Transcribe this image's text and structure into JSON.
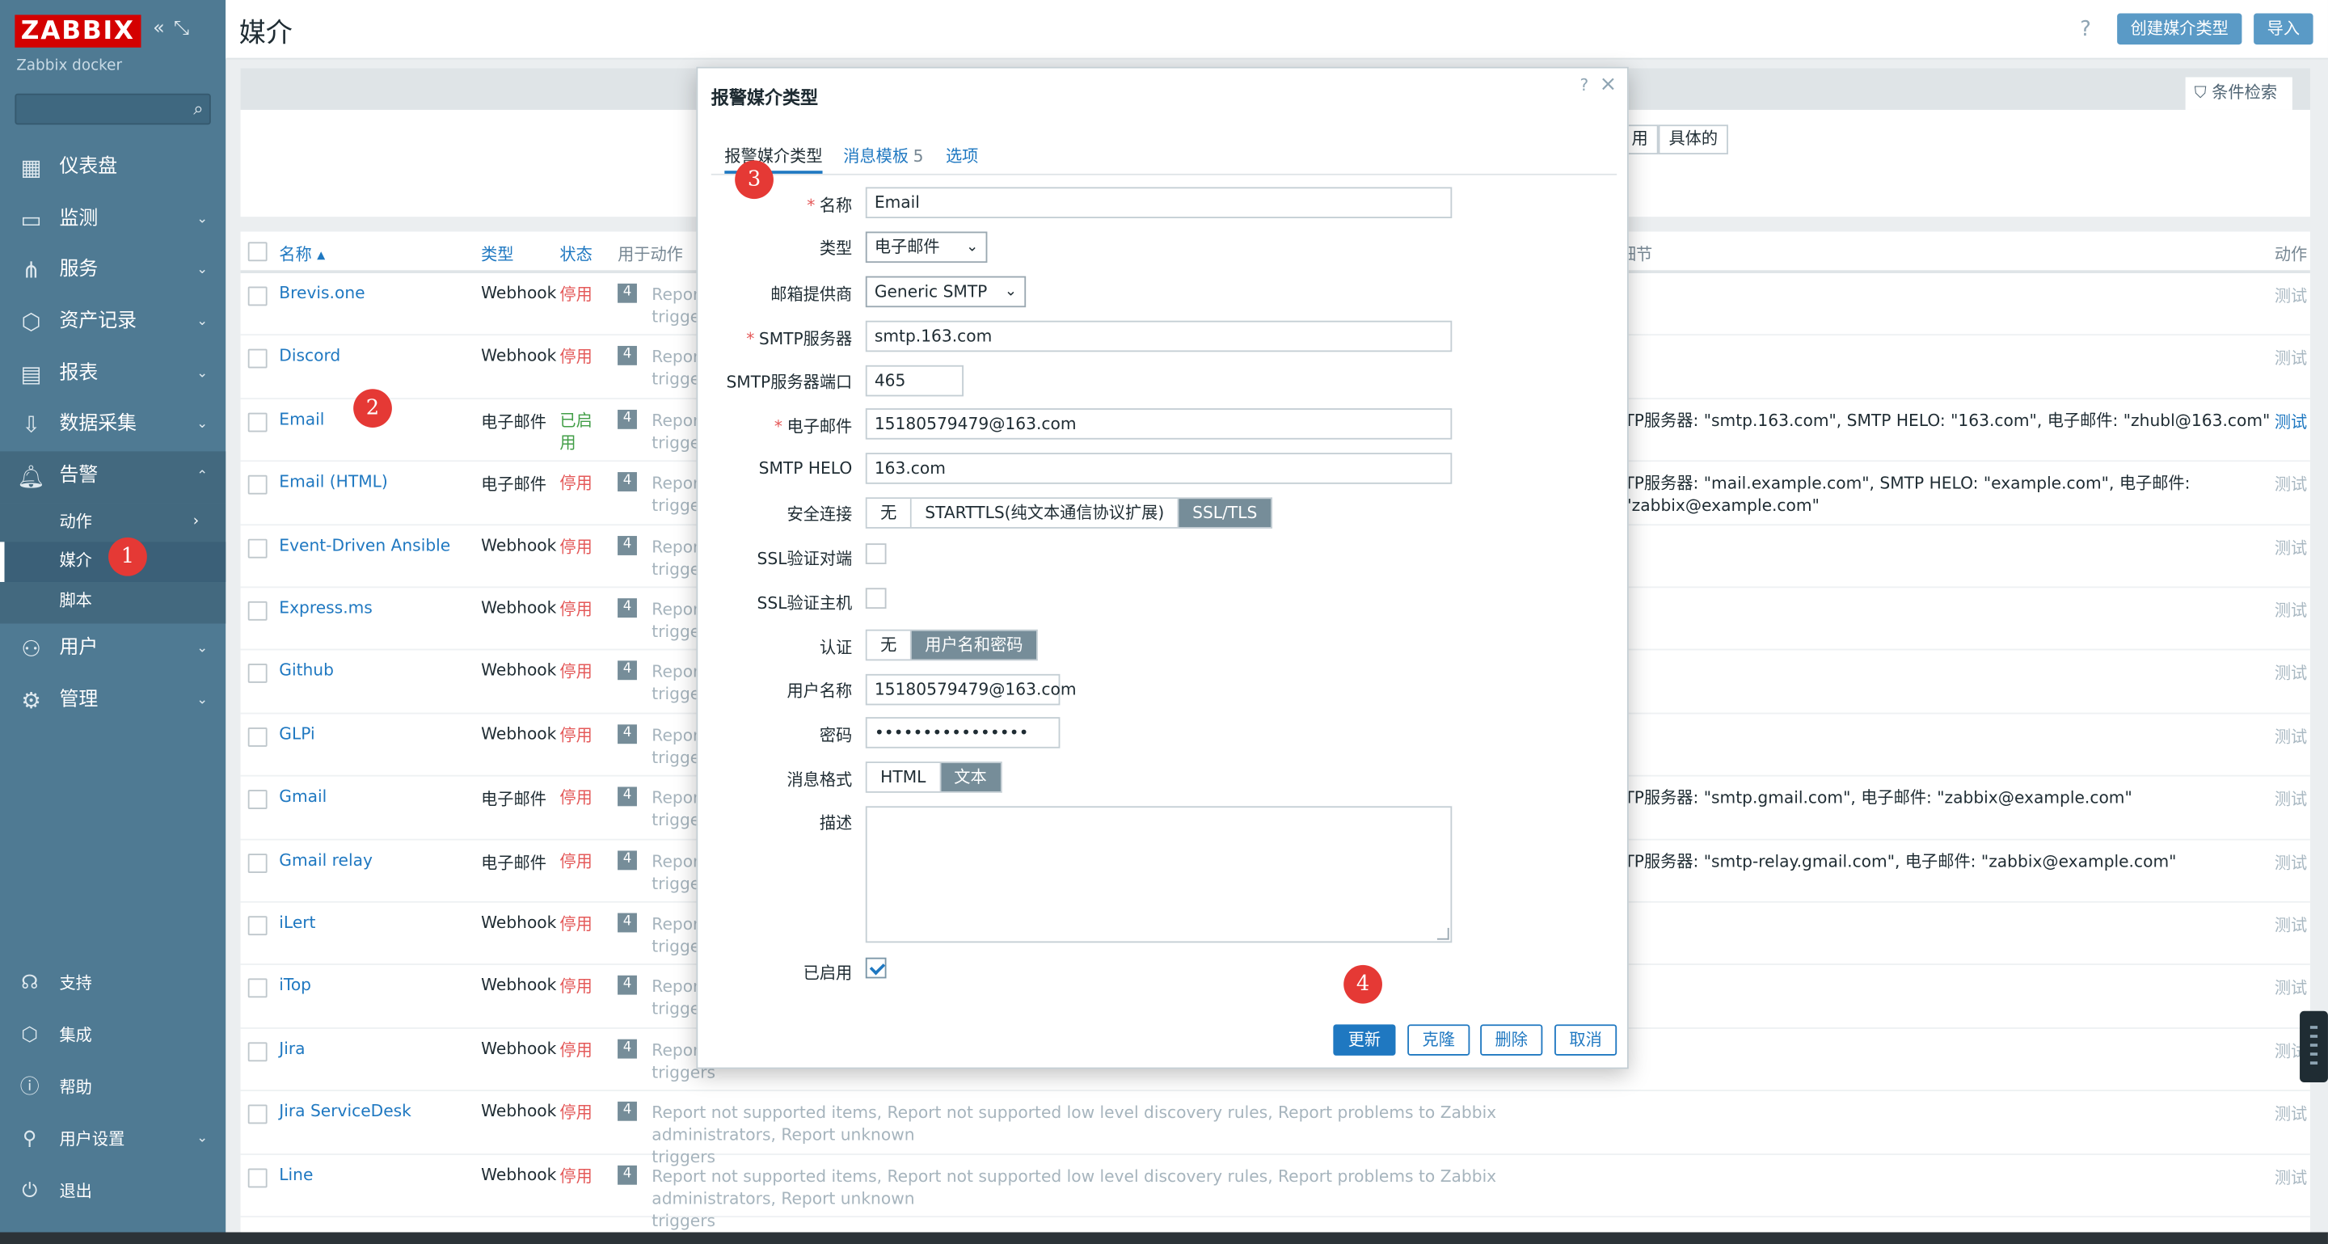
{
  "sidebar": {
    "logo": "ZABBIX",
    "host": "Zabbix docker",
    "menu": [
      {
        "label": "仪表盘",
        "icon": "dashboard-icon"
      },
      {
        "label": "监测",
        "icon": "monitoring-icon"
      },
      {
        "label": "服务",
        "icon": "services-icon"
      },
      {
        "label": "资产记录",
        "icon": "inventory-icon"
      },
      {
        "label": "报表",
        "icon": "reports-icon"
      },
      {
        "label": "数据采集",
        "icon": "data-collection-icon"
      },
      {
        "label": "告警",
        "icon": "bell-icon"
      }
    ],
    "alerts_sub": [
      "动作",
      "媒介",
      "脚本"
    ],
    "menu2": [
      {
        "label": "用户",
        "icon": "users-icon"
      },
      {
        "label": "管理",
        "icon": "gear-icon"
      }
    ],
    "bottom": [
      {
        "label": "支持",
        "icon": "headset-icon"
      },
      {
        "label": "集成",
        "icon": "integrations-icon"
      },
      {
        "label": "帮助",
        "icon": "help-icon"
      },
      {
        "label": "用户设置",
        "icon": "user-icon"
      },
      {
        "label": "退出",
        "icon": "power-icon"
      }
    ]
  },
  "header": {
    "title": "媒介",
    "create_btn": "创建媒介类型",
    "import_btn": "导入",
    "filter_tab": "条件检索",
    "seg_used": "用",
    "seg_specific": "具体的"
  },
  "table": {
    "columns": {
      "name": "名称",
      "type": "类型",
      "status": "状态",
      "used_in": "用于动作",
      "details": "细节",
      "actions": "动作"
    },
    "rows": [
      {
        "name": "Brevis.one",
        "type": "Webhook",
        "status": "停用",
        "enabled": false,
        "count": "4",
        "actions": "Report",
        "actions2": "trigger",
        "details": "",
        "test": "测试"
      },
      {
        "name": "Discord",
        "type": "Webhook",
        "status": "停用",
        "enabled": false,
        "count": "4",
        "actions": "Report",
        "actions2": "trigger",
        "details": "",
        "test": "测试"
      },
      {
        "name": "Email",
        "type": "电子邮件",
        "status": "已启用",
        "enabled": true,
        "count": "4",
        "actions": "Report",
        "actions2": "trigger",
        "details": "TP服务器: \"smtp.163.com\", SMTP HELO: \"163.com\", 电子邮件: \"zhubl@163.com\"",
        "test": "测试"
      },
      {
        "name": "Email (HTML)",
        "type": "电子邮件",
        "status": "停用",
        "enabled": false,
        "count": "4",
        "actions": "Report",
        "actions2": "trigger",
        "details": "TP服务器: \"mail.example.com\", SMTP HELO: \"example.com\", 电子邮件: \"zabbix@example.com\"",
        "test": "测试"
      },
      {
        "name": "Event-Driven Ansible",
        "type": "Webhook",
        "status": "停用",
        "enabled": false,
        "count": "4",
        "actions": "Report",
        "actions2": "trigger",
        "details": "",
        "test": "测试"
      },
      {
        "name": "Express.ms",
        "type": "Webhook",
        "status": "停用",
        "enabled": false,
        "count": "4",
        "actions": "Report",
        "actions2": "trigger",
        "details": "",
        "test": "测试"
      },
      {
        "name": "Github",
        "type": "Webhook",
        "status": "停用",
        "enabled": false,
        "count": "4",
        "actions": "Report",
        "actions2": "trigger",
        "details": "",
        "test": "测试"
      },
      {
        "name": "GLPi",
        "type": "Webhook",
        "status": "停用",
        "enabled": false,
        "count": "4",
        "actions": "Report",
        "actions2": "trigger",
        "details": "",
        "test": "测试"
      },
      {
        "name": "Gmail",
        "type": "电子邮件",
        "status": "停用",
        "enabled": false,
        "count": "4",
        "actions": "Report",
        "actions2": "trigger",
        "details": "TP服务器: \"smtp.gmail.com\", 电子邮件: \"zabbix@example.com\"",
        "test": "测试"
      },
      {
        "name": "Gmail relay",
        "type": "电子邮件",
        "status": "停用",
        "enabled": false,
        "count": "4",
        "actions": "Report",
        "actions2": "trigger",
        "details": "TP服务器: \"smtp-relay.gmail.com\", 电子邮件: \"zabbix@example.com\"",
        "test": "测试"
      },
      {
        "name": "iLert",
        "type": "Webhook",
        "status": "停用",
        "enabled": false,
        "count": "4",
        "actions": "Report",
        "actions2": "trigger",
        "details": "",
        "test": "测试"
      },
      {
        "name": "iTop",
        "type": "Webhook",
        "status": "停用",
        "enabled": false,
        "count": "4",
        "actions": "Report",
        "actions2": "trigger",
        "details": "",
        "test": "测试"
      },
      {
        "name": "Jira",
        "type": "Webhook",
        "status": "停用",
        "enabled": false,
        "count": "4",
        "actions": "Report",
        "actions2": "triggers",
        "details": "",
        "test": "测试"
      },
      {
        "name": "Jira ServiceDesk",
        "type": "Webhook",
        "status": "停用",
        "enabled": false,
        "count": "4",
        "actions": "Report not supported items, Report not supported low level discovery rules, Report problems to Zabbix administrators, Report unknown",
        "actions2": "triggers",
        "details": "",
        "test": "测试"
      },
      {
        "name": "Line",
        "type": "Webhook",
        "status": "停用",
        "enabled": false,
        "count": "4",
        "actions": "Report not supported items, Report not supported low level discovery rules, Report problems to Zabbix administrators, Report unknown",
        "actions2": "triggers",
        "details": "",
        "test": "测试"
      }
    ]
  },
  "modal": {
    "title": "报警媒介类型",
    "tabs": [
      {
        "label": "报警媒介类型"
      },
      {
        "label": "消息模板",
        "count": "5"
      },
      {
        "label": "选项"
      }
    ],
    "fields": {
      "name_label": "名称",
      "name_value": "Email",
      "type_label": "类型",
      "type_value": "电子邮件",
      "provider_label": "邮箱提供商",
      "provider_value": "Generic SMTP",
      "smtp_server_label": "SMTP服务器",
      "smtp_server_value": "smtp.163.com",
      "smtp_port_label": "SMTP服务器端口",
      "smtp_port_value": "465",
      "email_label": "电子邮件",
      "email_value": "15180579479@163.com",
      "helo_label": "SMTP HELO",
      "helo_value": "163.com",
      "security_label": "安全连接",
      "security_options": [
        "无",
        "STARTTLS(纯文本通信协议扩展)",
        "SSL/TLS"
      ],
      "security_selected": "SSL/TLS",
      "verify_peer_label": "SSL验证对端",
      "verify_host_label": "SSL验证主机",
      "auth_label": "认证",
      "auth_options": [
        "无",
        "用户名和密码"
      ],
      "auth_selected": "用户名和密码",
      "username_label": "用户名称",
      "username_value": "15180579479@163.com",
      "password_label": "密码",
      "password_value": "••••••••••••••••",
      "format_label": "消息格式",
      "format_options": [
        "HTML",
        "文本"
      ],
      "format_selected": "文本",
      "desc_label": "描述",
      "enabled_label": "已启用"
    },
    "buttons": {
      "update": "更新",
      "clone": "克隆",
      "delete": "删除",
      "cancel": "取消"
    },
    "help": "?",
    "close": "×"
  },
  "markers": [
    "1",
    "2",
    "3",
    "4"
  ]
}
